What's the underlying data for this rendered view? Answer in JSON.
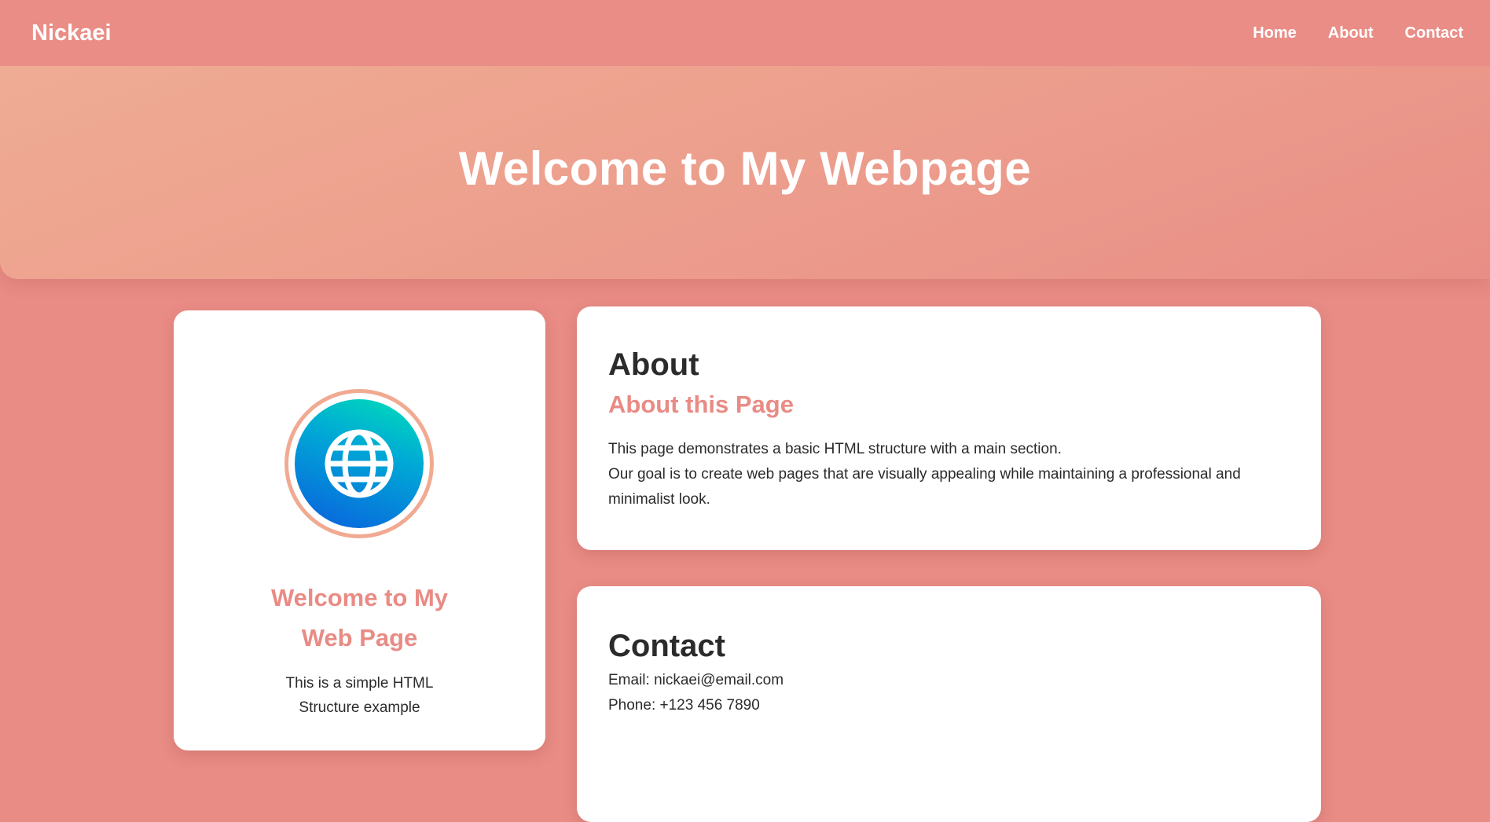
{
  "navbar": {
    "brand": "Nickaei",
    "links": [
      "Home",
      "About",
      "Contact"
    ]
  },
  "hero": {
    "title": "Welcome to My Webpage"
  },
  "profile_card": {
    "icon": "globe-icon",
    "heading": "Welcome to My Web Page",
    "text": "This is a simple HTML Structure example"
  },
  "about": {
    "title": "About",
    "subtitle": "About this Page",
    "line1": "This page demonstrates a basic HTML structure with a main section.",
    "line2": "Our goal is to create web pages that are visually appealing while maintaining a professional and minimalist look."
  },
  "contact": {
    "title": "Contact",
    "email": "Email: nickaei@email.com",
    "phone": "Phone: +123 456 7890"
  },
  "colors": {
    "background": "#e98c85",
    "accent": "#e98b85",
    "hero_gradient_start": "#efac94",
    "globe_gradient_top": "#00e0b8",
    "globe_gradient_bottom": "#0a5fde"
  }
}
